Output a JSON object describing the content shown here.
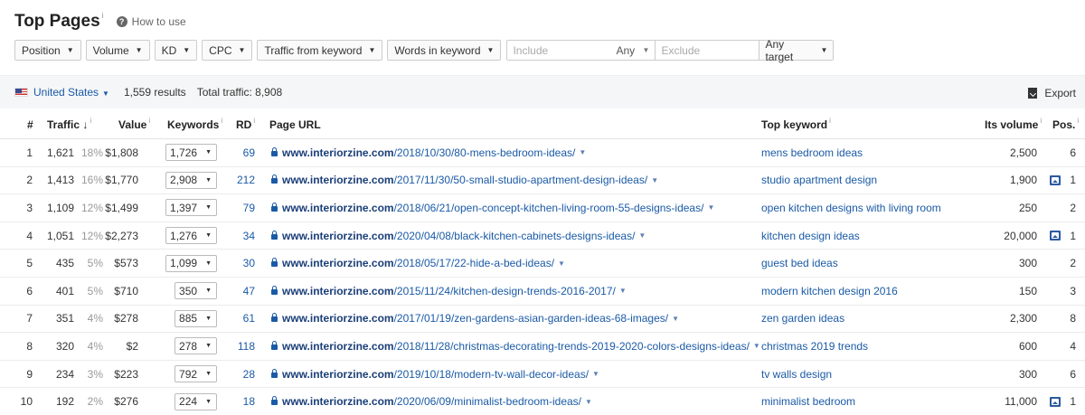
{
  "header": {
    "title": "Top Pages",
    "title_info": "i",
    "help_label": "How to use"
  },
  "filters": {
    "position": "Position",
    "volume": "Volume",
    "kd": "KD",
    "cpc": "CPC",
    "traffic_from_keyword": "Traffic from keyword",
    "words_in_keyword": "Words in keyword",
    "include_placeholder": "Include",
    "any": "Any",
    "exclude_placeholder": "Exclude",
    "any_target": "Any target"
  },
  "infobar": {
    "country": "United States",
    "results": "1,559 results",
    "total_traffic": "Total traffic: 8,908",
    "export": "Export"
  },
  "table": {
    "headers": {
      "num": "#",
      "traffic": "Traffic",
      "traffic_sort": "↓",
      "value": "Value",
      "keywords": "Keywords",
      "rd": "RD",
      "page_url": "Page URL",
      "top_keyword": "Top keyword",
      "its_volume": "Its volume",
      "pos": "Pos."
    },
    "rows": [
      {
        "num": "1",
        "traffic": "1,621",
        "pct": "18%",
        "value": "$1,808",
        "keywords": "1,726",
        "rd": "69",
        "domain": "www.interiorzine.com",
        "path": "/2018/10/30/80-mens-bedroom-ideas/",
        "top_keyword": "mens bedroom ideas",
        "volume": "2,500",
        "pos": "6",
        "serp": false
      },
      {
        "num": "2",
        "traffic": "1,413",
        "pct": "16%",
        "value": "$1,770",
        "keywords": "2,908",
        "rd": "212",
        "domain": "www.interiorzine.com",
        "path": "/2017/11/30/50-small-studio-apartment-design-ideas/",
        "top_keyword": "studio apartment design",
        "volume": "1,900",
        "pos": "1",
        "serp": true
      },
      {
        "num": "3",
        "traffic": "1,109",
        "pct": "12%",
        "value": "$1,499",
        "keywords": "1,397",
        "rd": "79",
        "domain": "www.interiorzine.com",
        "path": "/2018/06/21/open-concept-kitchen-living-room-55-designs-ideas/",
        "top_keyword": "open kitchen designs with living room",
        "volume": "250",
        "pos": "2",
        "serp": false
      },
      {
        "num": "4",
        "traffic": "1,051",
        "pct": "12%",
        "value": "$2,273",
        "keywords": "1,276",
        "rd": "34",
        "domain": "www.interiorzine.com",
        "path": "/2020/04/08/black-kitchen-cabinets-designs-ideas/",
        "top_keyword": "kitchen design ideas",
        "volume": "20,000",
        "pos": "1",
        "serp": true
      },
      {
        "num": "5",
        "traffic": "435",
        "pct": "5%",
        "value": "$573",
        "keywords": "1,099",
        "rd": "30",
        "domain": "www.interiorzine.com",
        "path": "/2018/05/17/22-hide-a-bed-ideas/",
        "top_keyword": "guest bed ideas",
        "volume": "300",
        "pos": "2",
        "serp": false
      },
      {
        "num": "6",
        "traffic": "401",
        "pct": "5%",
        "value": "$710",
        "keywords": "350",
        "rd": "47",
        "domain": "www.interiorzine.com",
        "path": "/2015/11/24/kitchen-design-trends-2016-2017/",
        "top_keyword": "modern kitchen design 2016",
        "volume": "150",
        "pos": "3",
        "serp": false
      },
      {
        "num": "7",
        "traffic": "351",
        "pct": "4%",
        "value": "$278",
        "keywords": "885",
        "rd": "61",
        "domain": "www.interiorzine.com",
        "path": "/2017/01/19/zen-gardens-asian-garden-ideas-68-images/",
        "top_keyword": "zen garden ideas",
        "volume": "2,300",
        "pos": "8",
        "serp": false
      },
      {
        "num": "8",
        "traffic": "320",
        "pct": "4%",
        "value": "$2",
        "keywords": "278",
        "rd": "118",
        "domain": "www.interiorzine.com",
        "path": "/2018/11/28/christmas-decorating-trends-2019-2020-colors-designs-ideas/",
        "top_keyword": "christmas 2019 trends",
        "volume": "600",
        "pos": "4",
        "serp": false
      },
      {
        "num": "9",
        "traffic": "234",
        "pct": "3%",
        "value": "$223",
        "keywords": "792",
        "rd": "28",
        "domain": "www.interiorzine.com",
        "path": "/2019/10/18/modern-tv-wall-decor-ideas/",
        "top_keyword": "tv walls design",
        "volume": "300",
        "pos": "6",
        "serp": false
      },
      {
        "num": "10",
        "traffic": "192",
        "pct": "2%",
        "value": "$276",
        "keywords": "224",
        "rd": "18",
        "domain": "www.interiorzine.com",
        "path": "/2020/06/09/minimalist-bedroom-ideas/",
        "top_keyword": "minimalist bedroom",
        "volume": "11,000",
        "pos": "1",
        "serp": true
      }
    ]
  },
  "colors": {
    "link": "#1a5aa6",
    "domain_bold": "#1a3e78",
    "muted": "#999999",
    "infobar_bg": "#f5f6f7"
  },
  "icons": {
    "help": "question-circle-icon",
    "flag": "us-flag-icon",
    "export": "download-icon",
    "lock": "lock-icon",
    "serp": "serp-feature-image-icon",
    "dropdown": "caret-down-icon"
  }
}
